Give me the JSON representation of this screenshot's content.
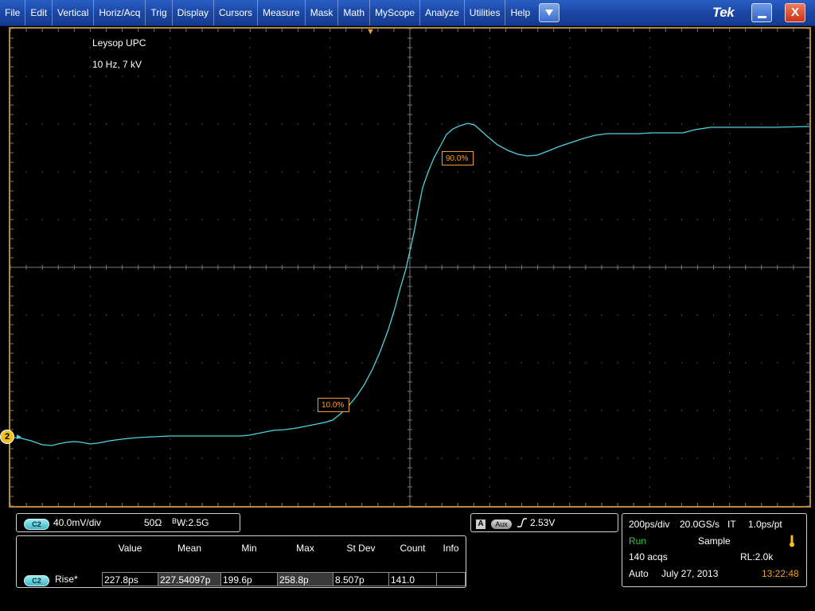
{
  "menu": {
    "items": [
      "File",
      "Edit",
      "Vertical",
      "Horiz/Acq",
      "Trig",
      "Display",
      "Cursors",
      "Measure",
      "Mask",
      "Math",
      "MyScope",
      "Analyze",
      "Utilities",
      "Help"
    ],
    "dropdown_icon": "triangle-down",
    "logo": "Tek",
    "minimize_icon": "minimize",
    "close_label": "X",
    "colors": {
      "bar": "#1c49a8"
    }
  },
  "display": {
    "annotation_line1": "Leysop UPC",
    "annotation_line2": "10 Hz, 7 kV",
    "channel_marker": "2",
    "ref_low_label": "10.0%",
    "ref_high_label": "90.0%",
    "colors": {
      "trace": "#4fd3e0",
      "border": "#b88a3a",
      "ref": "#f0a030"
    }
  },
  "channel_panel": {
    "channel": "C2",
    "scale": "40.0mV/div",
    "impedance": "50Ω",
    "bw_label": "W",
    "bw_prefix": "B",
    "bandwidth": ":2.5G"
  },
  "trigger_panel": {
    "mode_box": "A",
    "source": "Aux",
    "slope_icon": "rising-edge",
    "level": "2.53V"
  },
  "measurements": {
    "headers": [
      "Value",
      "Mean",
      "Min",
      "Max",
      "St Dev",
      "Count",
      "Info"
    ],
    "rows": [
      {
        "channel": "C2",
        "name": "Rise*",
        "value": "227.8ps",
        "mean": "227.54097p",
        "min": "199.6p",
        "max": "258.8p",
        "stdev": "8.507p",
        "count": "141.0",
        "info": ""
      }
    ]
  },
  "acq_panel": {
    "timebase": "200ps/div",
    "sample_rate": "20.0GS/s",
    "mode_it": "IT",
    "resolution": "1.0ps/pt",
    "state": "Run",
    "acq_mode": "Sample",
    "acqs": "140 acqs",
    "record_length": "RL:2.0k",
    "trigger_mode": "Auto",
    "date": "July 27, 2013",
    "time": "13:22:48",
    "colors": {
      "run": "#2ecc40",
      "time": "#f0a030",
      "thermo": "#f0c020"
    }
  }
}
